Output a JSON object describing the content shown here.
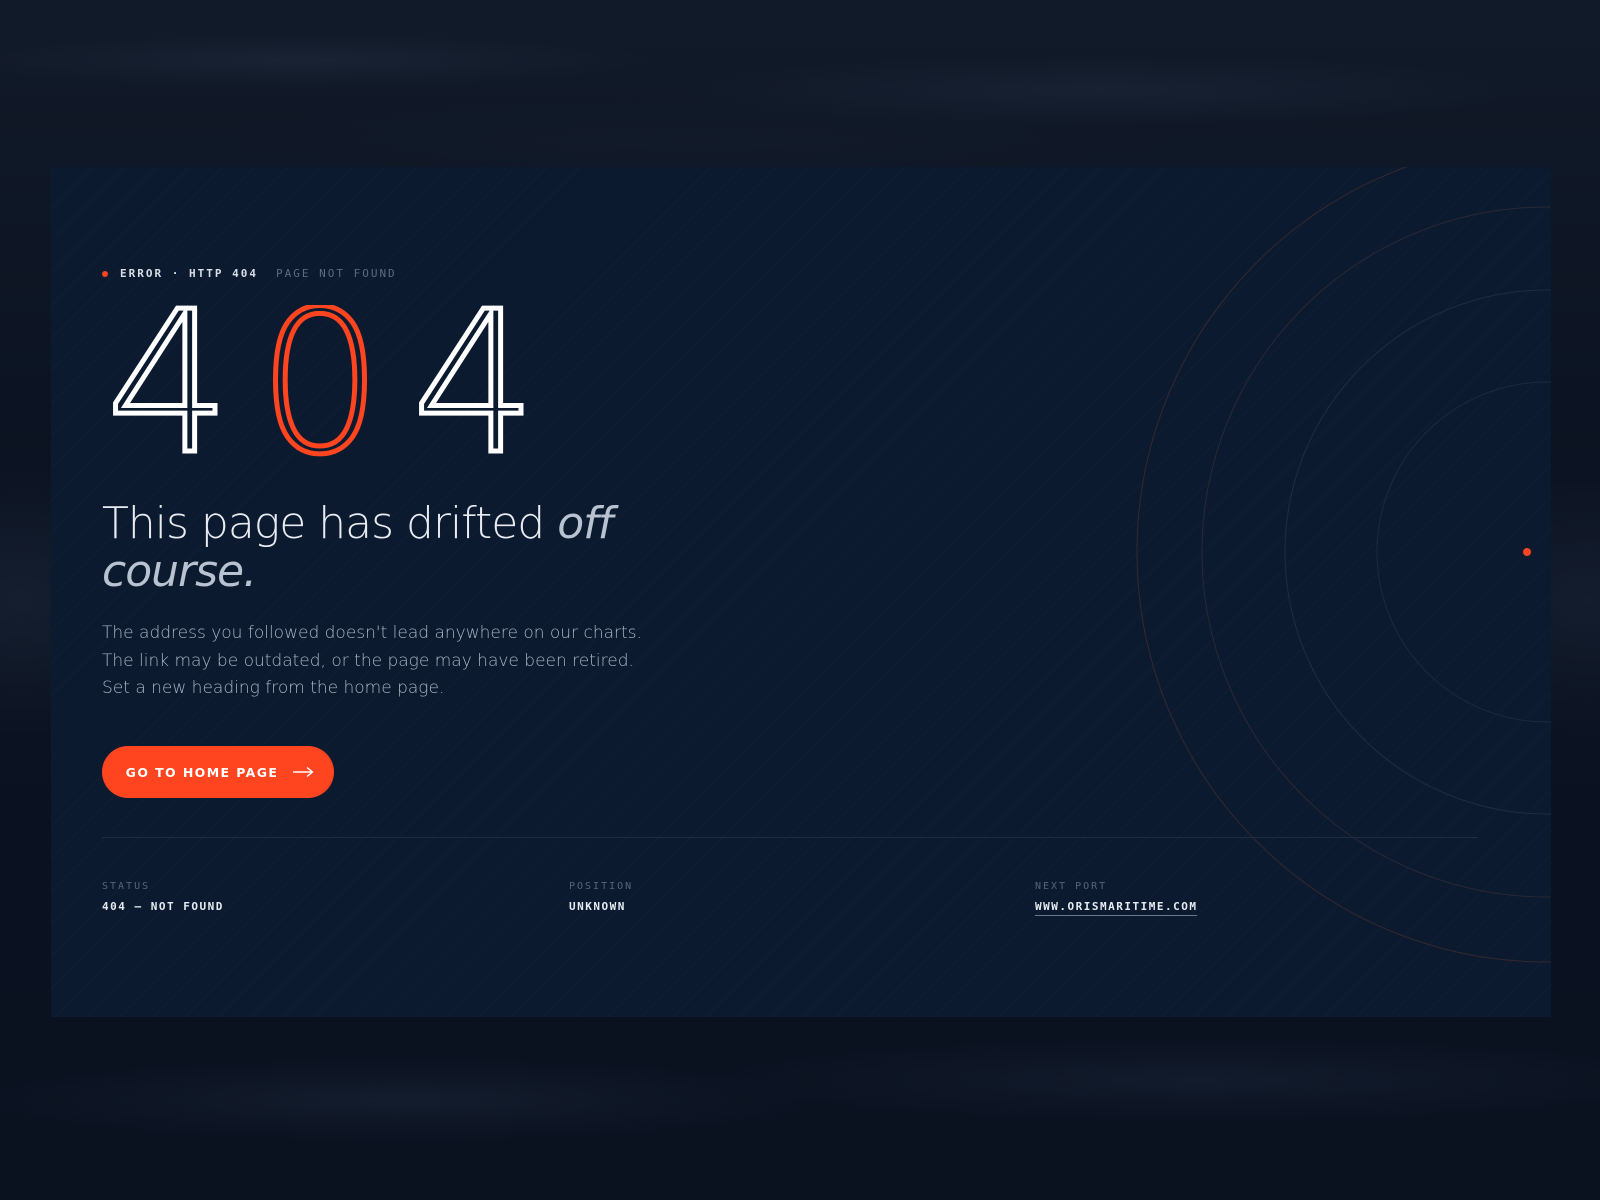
{
  "colors": {
    "accent": "#ff4520",
    "card_background": "#0b1a2f",
    "page_background": "#0a1220",
    "text_primary": "#e8ecf2",
    "text_muted": "#aab5c4"
  },
  "eyebrow": {
    "primary": "ERROR · HTTP 404",
    "secondary": "PAGE NOT FOUND"
  },
  "code": {
    "digit1": "4",
    "digit2": "0",
    "digit3": "4"
  },
  "headline": {
    "plain": "This page has drifted ",
    "emphasis": "off course."
  },
  "body": {
    "line1": "The address you followed doesn't lead anywhere on our charts.",
    "line2": "The link may be outdated, or the page may have been retired.",
    "line3": "Set a new heading from the home page."
  },
  "cta": {
    "label": "GO TO HOME PAGE",
    "icon": "arrow-right-icon"
  },
  "meta": {
    "status_label": "STATUS",
    "status_value": "404 — NOT FOUND",
    "position_label": "POSITION",
    "position_value": "UNKNOWN",
    "port_label": "NEXT PORT",
    "port_value": "WWW.ORISMARITIME.COM"
  }
}
